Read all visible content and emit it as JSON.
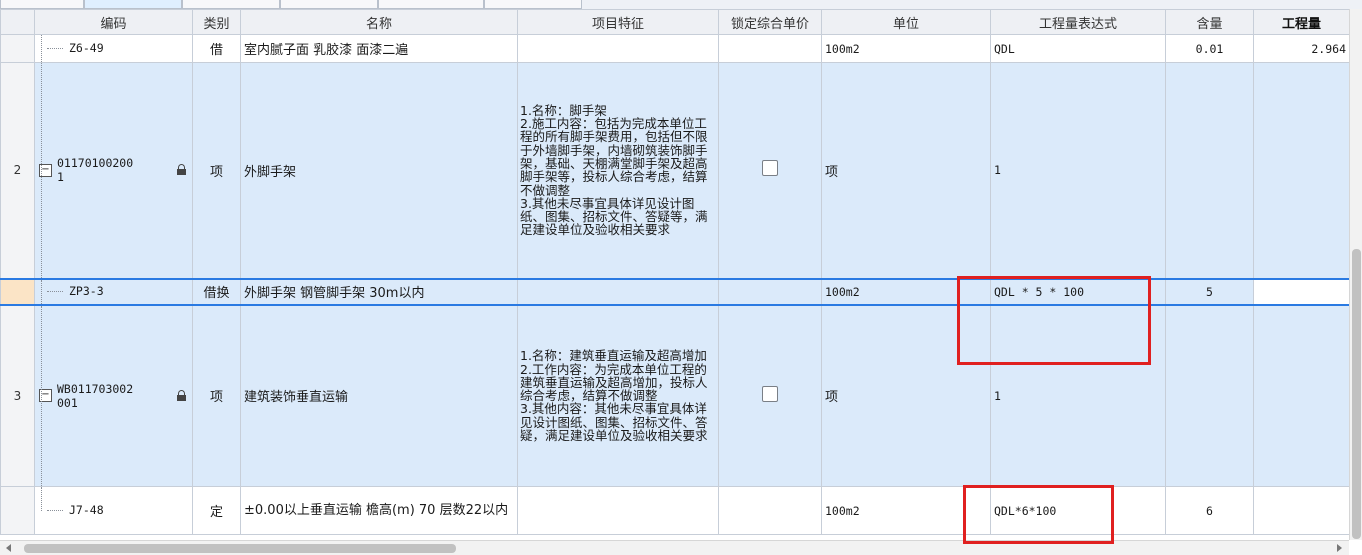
{
  "columns": {
    "index": "",
    "code": "编码",
    "category": "类别",
    "name": "名称",
    "features": "项目特征",
    "lock_price": "锁定综合单价",
    "unit": "单位",
    "expression": "工程量表达式",
    "content": "含量",
    "quantity": "工程量"
  },
  "rows": {
    "r0": {
      "index": "",
      "code": "Z6-49",
      "category": "借",
      "name": "室内腻子面 乳胶漆 面漆二遍",
      "features": "",
      "unit": "100m2",
      "expression": "QDL",
      "content": "0.01",
      "quantity": "2.964"
    },
    "r1": {
      "index": "2",
      "code_line1": "01170100200",
      "code_line2": "1",
      "category": "项",
      "name": "外脚手架",
      "features": "1.名称：脚手架\n2.施工内容：包括为完成本单位工程的所有脚手架费用，包括但不限于外墙脚手架，内墙砌筑装饰脚手架，基础、天棚满堂脚手架及超高脚手架等，投标人综合考虑，结算不做调整\n3.其他未尽事宜具体详见设计图纸、图集、招标文件、答疑等，满足建设单位及验收相关要求",
      "unit": "项",
      "expression": "1",
      "content": "",
      "quantity": ""
    },
    "r2": {
      "index": "",
      "code": "ZP3-3",
      "category": "借换",
      "name": "外脚手架 钢管脚手架 30m以内",
      "features": "",
      "unit": "100m2",
      "expression": "QDL * 5 * 100",
      "content": "5",
      "quantity": ""
    },
    "r3": {
      "index": "3",
      "code_line1": "WB011703002",
      "code_line2": "001",
      "category": "项",
      "name": "建筑装饰垂直运输",
      "features": "1.名称：建筑垂直运输及超高增加\n2.工作内容：为完成本单位工程的建筑垂直运输及超高增加，投标人综合考虑，结算不做调整\n3.其他内容：其他未尽事宜具体详见设计图纸、图集、招标文件、答疑，满足建设单位及验收相关要求",
      "unit": "项",
      "expression": "1",
      "content": "",
      "quantity": ""
    },
    "r4": {
      "index": "",
      "code": "J7-48",
      "category": "定",
      "name": "±0.00以上垂直运输 檐高(m) 70 层数22以内",
      "features": "",
      "unit": "100m2",
      "expression": "QDL*6*100",
      "content": "6",
      "quantity": ""
    }
  },
  "colors": {
    "selected_border": "#2a7ae2",
    "main_row_bg": "#dbeafa",
    "highlight_box": "#e02020"
  }
}
